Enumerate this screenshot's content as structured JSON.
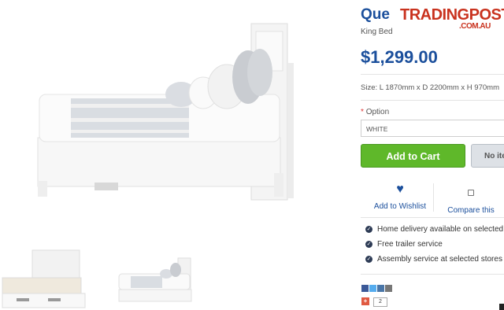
{
  "product": {
    "title": "Que",
    "subtitle": "King Bed",
    "price": "$1,299.00",
    "size": "Size: L 1870mm x D 2200mm x H 970mm"
  },
  "watermark": {
    "main": "TRADINGPOST",
    "sub": ".COM.AU"
  },
  "option": {
    "required_marker": "*",
    "label": "Option",
    "selected": "WHITE"
  },
  "buttons": {
    "add_to_cart": "Add to Cart",
    "no_item": "No ite"
  },
  "actions": {
    "wishlist": "Add to Wishlist",
    "compare": "Compare this"
  },
  "features": [
    "Home delivery available on selected pr",
    "Free trailer service",
    "Assembly service at selected stores"
  ],
  "social": {
    "gplus": "+",
    "gplus_count": "2"
  },
  "colors": {
    "brand_blue": "#1b4f9c",
    "cart_green": "#5fb82a"
  }
}
